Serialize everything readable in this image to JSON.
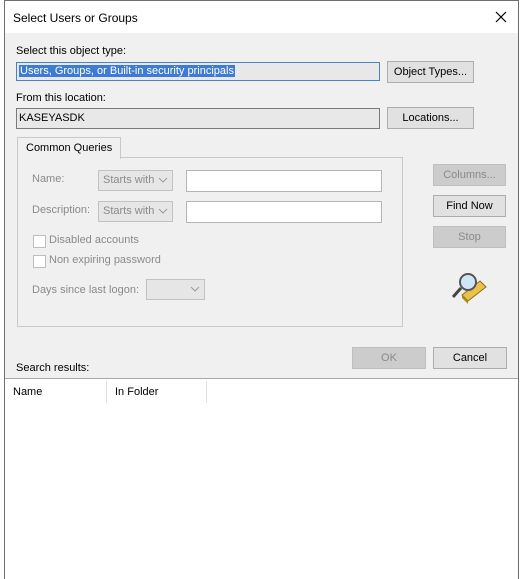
{
  "window": {
    "title": "Select Users or Groups"
  },
  "object_type": {
    "label": "Select this object type:",
    "value": "Users, Groups, or Built-in security principals",
    "button": "Object Types..."
  },
  "location": {
    "label": "From this location:",
    "value": "KASEYASDK",
    "button": "Locations..."
  },
  "tabs": [
    {
      "label": "Common Queries",
      "active": true
    }
  ],
  "queries": {
    "name_label": "Name:",
    "name_mode": "Starts with",
    "description_label": "Description:",
    "description_mode": "Starts with",
    "disabled_accounts": {
      "label": "Disabled accounts",
      "checked": false
    },
    "non_expiring": {
      "label": "Non expiring password",
      "checked": false
    },
    "days_label": "Days since last logon:",
    "days_value": ""
  },
  "side_buttons": {
    "columns": "Columns...",
    "find_now": "Find Now",
    "stop": "Stop"
  },
  "footer": {
    "ok": "OK",
    "cancel": "Cancel"
  },
  "results": {
    "label": "Search results:",
    "columns": [
      "Name",
      "In Folder"
    ]
  },
  "colors": {
    "selection": "#3d7bd4",
    "dialog_bg": "#f0f0f0"
  }
}
